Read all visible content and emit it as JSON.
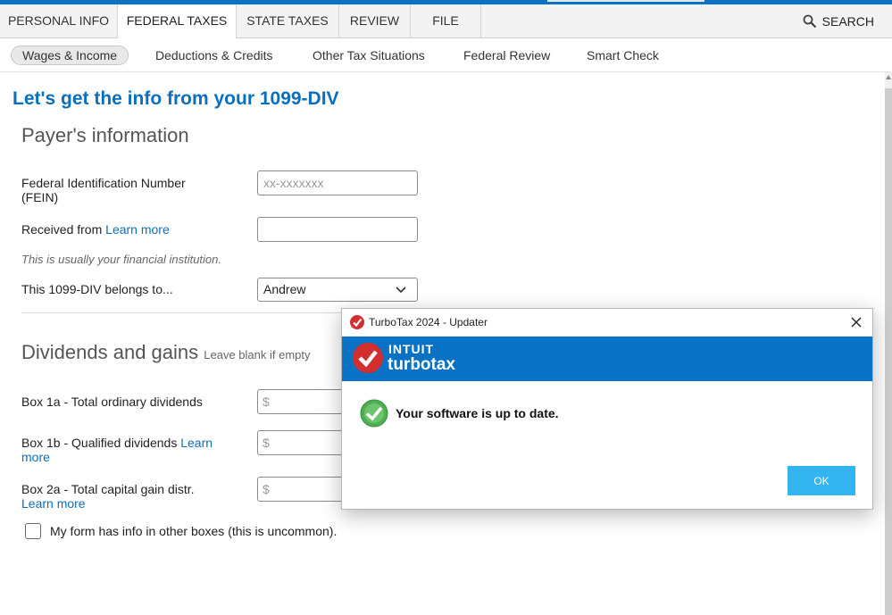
{
  "tabs": [
    "PERSONAL INFO",
    "FEDERAL TAXES",
    "STATE TAXES",
    "REVIEW",
    "FILE"
  ],
  "search_label": "SEARCH",
  "subnav": [
    "Wages & Income",
    "Deductions & Credits",
    "Other Tax Situations",
    "Federal Review",
    "Smart Check"
  ],
  "page_title": "Let's get the info from your 1099-DIV",
  "payer": {
    "heading": "Payer's information",
    "fein_label_line1": "Federal Identification Number",
    "fein_label_line2": "(FEIN)",
    "fein_placeholder": "xx-xxxxxxx",
    "received_label": "Received from",
    "learn_more": "Learn more",
    "received_hint": "This is usually your financial institution.",
    "belongs_label": "This 1099-DIV belongs to...",
    "belongs_value": "Andrew"
  },
  "dividends": {
    "heading": "Dividends and gains",
    "heading_note": "Leave blank if empty",
    "box1a_label": "Box 1a - Total ordinary dividends",
    "box1b_label": "Box 1b - Qualified dividends",
    "box1b_link1": "Learn",
    "box1b_link2": "more",
    "box2a_label": "Box 2a - Total capital gain distr.",
    "box2a_link": "Learn more",
    "currency": "$",
    "other_boxes_label": "My form has info in other boxes (this is uncommon)."
  },
  "dialog": {
    "title": "TurboTax 2024 - Updater",
    "brand_top": "INTUIT",
    "brand_bottom": "turbotax",
    "message": "Your software is up to date.",
    "ok_label": "OK"
  },
  "colors": {
    "accent_blue": "#0a72c4",
    "link_blue": "#0a6fbf",
    "ok_button": "#33b4ef",
    "check_green": "#4caf50",
    "logo_red": "#d32f2f"
  }
}
